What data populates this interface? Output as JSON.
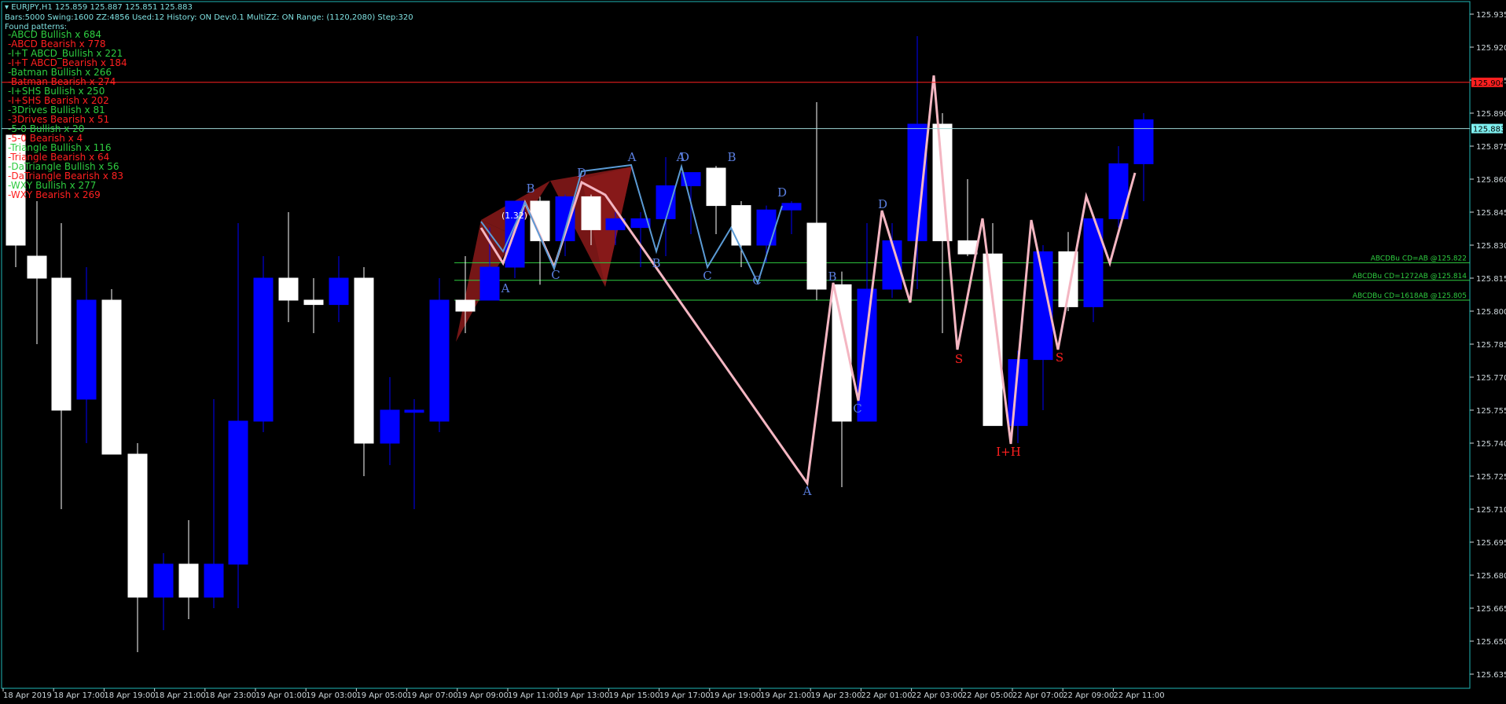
{
  "header": {
    "symbol_line": "EURJPY,H1  125.859 125.887 125.851 125.883",
    "settings_line": "Bars:5000  Swing:1600  ZZ:4856  Used:12  History: ON Dev:0.1  MultiZZ: ON  Range: (1120,2080)  Step:320",
    "found_label": "Found patterns:"
  },
  "patterns": [
    {
      "text": "-ABCD Bullish x 684",
      "color": "#2ecc40"
    },
    {
      "text": "-ABCD Bearish x 778",
      "color": "#ff2020"
    },
    {
      "text": "-I+T ABCD_Bullish x 221",
      "color": "#2ecc40"
    },
    {
      "text": "-I+T ABCD_Bearish x 184",
      "color": "#ff2020"
    },
    {
      "text": "-Batman Bullish x 266",
      "color": "#2ecc40"
    },
    {
      "text": "-Batman Bearish x 274",
      "color": "#ff2020"
    },
    {
      "text": "-I+SHS Bullish x 250",
      "color": "#2ecc40"
    },
    {
      "text": "-I+SHS Bearish x 202",
      "color": "#ff2020"
    },
    {
      "text": "-3Drives Bullish x 81",
      "color": "#2ecc40"
    },
    {
      "text": "-3Drives Bearish x 51",
      "color": "#ff2020"
    },
    {
      "text": "-5-0 Bullish x 20",
      "color": "#2ecc40"
    },
    {
      "text": "-5-0 Bearish x 4",
      "color": "#ff2020"
    },
    {
      "text": "-Triangle Bullish x 116",
      "color": "#2ecc40"
    },
    {
      "text": "-Triangle Bearish x 64",
      "color": "#ff2020"
    },
    {
      "text": "-DaTriangle Bullish x 56",
      "color": "#2ecc40"
    },
    {
      "text": "-DaTriangle Bearish x 83",
      "color": "#ff2020"
    },
    {
      "text": "-WXY Bullish x 277",
      "color": "#2ecc40"
    },
    {
      "text": "-WXY Bearish x 269",
      "color": "#ff2020"
    }
  ],
  "price_axis": {
    "labels": [
      "125.935",
      "125.920",
      "125.905",
      "125.890",
      "125.875",
      "125.860",
      "125.845",
      "125.830",
      "125.815",
      "125.800",
      "125.785",
      "125.770",
      "125.755",
      "125.740",
      "125.725",
      "125.710",
      "125.695",
      "125.680",
      "125.665",
      "125.650",
      "125.635"
    ],
    "red_marker": "125.904",
    "current_marker": "125.883"
  },
  "time_axis": {
    "labels": [
      "18 Apr 2019",
      "18 Apr 17:00",
      "18 Apr 19:00",
      "18 Apr 21:00",
      "18 Apr 23:00",
      "19 Apr 01:00",
      "19 Apr 03:00",
      "19 Apr 05:00",
      "19 Apr 07:00",
      "19 Apr 09:00",
      "19 Apr 11:00",
      "19 Apr 13:00",
      "19 Apr 15:00",
      "19 Apr 17:00",
      "19 Apr 19:00",
      "19 Apr 21:00",
      "19 Apr 23:00",
      "22 Apr 01:00",
      "22 Apr 03:00",
      "22 Apr 05:00",
      "22 Apr 07:00",
      "22 Apr 09:00",
      "22 Apr 11:00"
    ]
  },
  "level_labels": [
    {
      "text": "ABCDBu CD=AB   @125.822",
      "price": 125.822
    },
    {
      "text": "ABCDBu CD=1272AB  @125.814",
      "price": 125.814
    },
    {
      "text": "ABCDBu CD=1618AB  @125.805",
      "price": 125.805
    }
  ],
  "annotation": "(1.32)",
  "point_labels": [
    "A",
    "B",
    "C",
    "D",
    "A",
    "B",
    "C",
    "D",
    "A",
    "B",
    "C",
    "D",
    "A",
    "B",
    "C",
    "D",
    "S",
    "S",
    "I+H"
  ],
  "colors": {
    "background": "#000000",
    "frame": "#1fb6b6",
    "bull_candle": "#0000ff",
    "bear_candle": "#ffffff",
    "zigzag_pink": "#f4b6c2",
    "zigzag_blue": "#5b9bd5",
    "pattern_fill": "#8b1a1a",
    "level_green": "#2ecc40",
    "level_red": "#ff2020",
    "label_blue": "#5b7fe0",
    "label_red": "#ff2020"
  }
}
